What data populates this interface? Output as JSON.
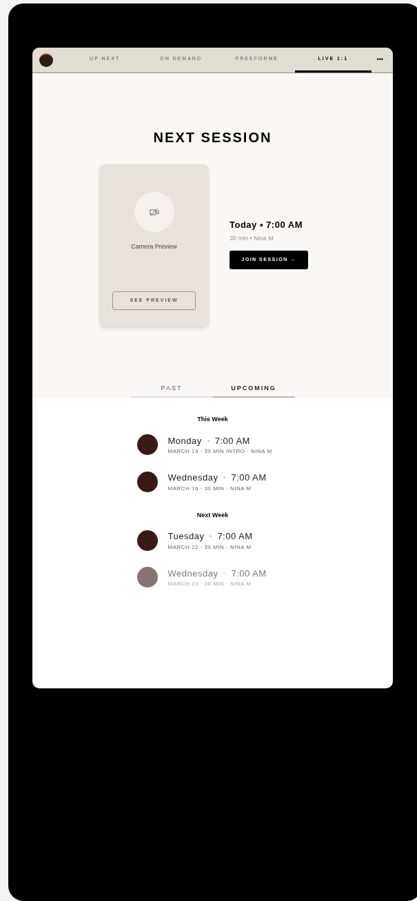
{
  "nav": {
    "tabs": [
      {
        "label": "UP NEXT",
        "selected": false
      },
      {
        "label": "ON DEMAND",
        "selected": false
      },
      {
        "label": "FREEFORME",
        "selected": false
      },
      {
        "label": "LIVE 1:1",
        "selected": true
      }
    ],
    "more": "•••"
  },
  "hero": {
    "title": "NEXT SESSION",
    "preview": {
      "label": "Camera Preview",
      "button": "SEE PREVIEW"
    },
    "when": "Today • 7:00 AM",
    "detail": "30 min • Nina M",
    "join_button": "JOIN SESSION →"
  },
  "session_tabs": [
    {
      "label": "PAST",
      "selected": false
    },
    {
      "label": "UPCOMING",
      "selected": true
    }
  ],
  "groups": [
    {
      "heading": "This Week",
      "sessions": [
        {
          "day": "Monday",
          "time": "7:00 AM",
          "meta": "MARCH 14 · 30 MIN INTRO · NINA M",
          "faded": false
        },
        {
          "day": "Wednesday",
          "time": "7:00 AM",
          "meta": "MARCH 16 · 30 MIN · NINA M",
          "faded": false
        }
      ]
    },
    {
      "heading": "Next Week",
      "sessions": [
        {
          "day": "Tuesday",
          "time": "7:00 AM",
          "meta": "MARCH 22 · 30 MIN · NINA M",
          "faded": false
        },
        {
          "day": "Wednesday",
          "time": "7:00 AM",
          "meta": "MARCH 23 · 30 MIN · NINA M",
          "faded": true
        }
      ]
    }
  ]
}
